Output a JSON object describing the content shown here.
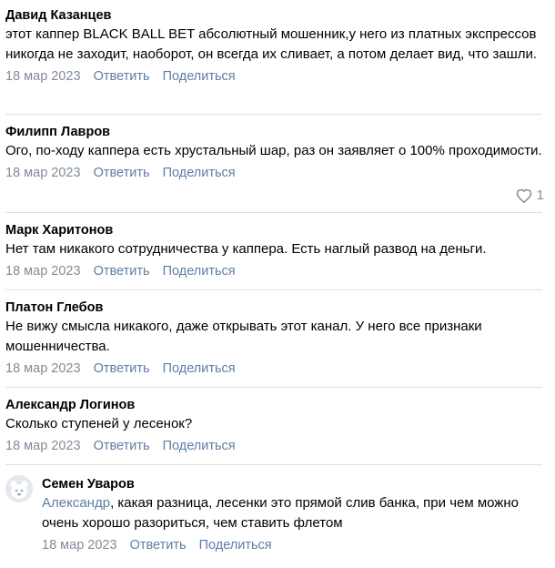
{
  "comments": [
    {
      "author": "Давид Казанцев",
      "text": "этот каппер BLACK BALL BET абсолютный мошенник,у него из платных экспрессов никогда не заходит, наоборот, он всегда их сливает, а потом делает вид, что зашли.",
      "date": "18 мар 2023",
      "reply_label": "Ответить",
      "share_label": "Поделиться"
    },
    {
      "author": "Филипп Лавров",
      "text": "Ого, по-ходу каппера есть хрустальный шар, раз он заявляет о 100% проходимости.",
      "date": "18 мар 2023",
      "reply_label": "Ответить",
      "share_label": "Поделиться",
      "likes": "1"
    },
    {
      "author": "Марк Харитонов",
      "text": "Нет там никакого сотрудничества у каппера. Есть наглый развод на деньги.",
      "date": "18 мар 2023",
      "reply_label": "Ответить",
      "share_label": "Поделиться"
    },
    {
      "author": "Платон Глебов",
      "text": "Не вижу смысла никакого, даже открывать этот канал. У него все признаки мошенничества.",
      "date": "18 мар 2023",
      "reply_label": "Ответить",
      "share_label": "Поделиться"
    },
    {
      "author": "Александр Логинов",
      "text": "Сколько ступеней у лесенок?",
      "date": "18 мар 2023",
      "reply_label": "Ответить",
      "share_label": "Поделиться"
    },
    {
      "author": "Семен Уваров",
      "mention": "Александр",
      "text": ", какая разница, лесенки это прямой слив банка, при чем можно очень хорошо разориться, чем ставить флетом",
      "date": "18 мар 2023",
      "reply_label": "Ответить",
      "share_label": "Поделиться",
      "avatar_icon": "default-avatar-icon"
    }
  ],
  "colors": {
    "link": "#5f7ea6",
    "meta": "#818c99",
    "divider": "#dce1e6",
    "avatar_bg": "#e3e9ef"
  }
}
